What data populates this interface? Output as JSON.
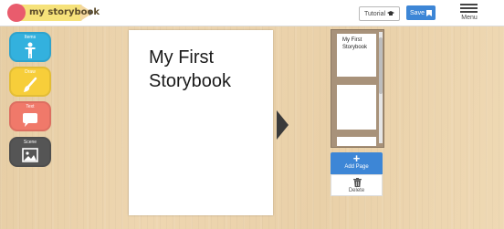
{
  "app": {
    "logo_text": "my storybook"
  },
  "header": {
    "tutorial_label": "Tutorial",
    "tutorial_icon": "graduation-cap-icon",
    "save_label": "Save",
    "save_icon": "bookmark-icon",
    "menu_label": "Menu",
    "menu_icon": "hamburger-icon"
  },
  "tools": [
    {
      "label": "Items",
      "icon": "person-icon",
      "color": "#33b1de"
    },
    {
      "label": "Draw",
      "icon": "brush-icon",
      "color": "#f7ce3a"
    },
    {
      "label": "Text",
      "icon": "speech-bubble-icon",
      "color": "#f0796a"
    },
    {
      "label": "Scene",
      "icon": "picture-icon",
      "color": "#555555"
    }
  ],
  "page": {
    "title": "My First\nStorybook"
  },
  "thumbnails": [
    {
      "text": "My First\nStorybook"
    },
    {
      "text": ""
    },
    {
      "text": ""
    }
  ],
  "actions": {
    "add_page_label": "Add Page",
    "add_page_icon": "plus-icon",
    "delete_label": "Delete",
    "delete_icon": "trash-icon"
  }
}
